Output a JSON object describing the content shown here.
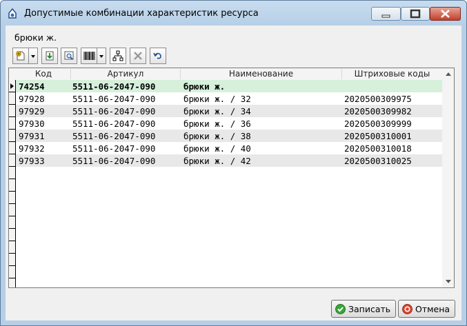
{
  "window": {
    "title": "Допустимые комбинации характеристик ресурса"
  },
  "subtitle": "брюки  ж.",
  "toolbar": {
    "buttons": [
      {
        "icon": "add-document-icon"
      },
      {
        "icon": "export-icon"
      },
      {
        "icon": "preview-icon"
      },
      {
        "icon": "barcode-icon"
      },
      {
        "icon": "hierarchy-icon"
      },
      {
        "icon": "delete-icon"
      },
      {
        "icon": "undo-icon"
      }
    ]
  },
  "grid": {
    "columns": [
      "Код",
      "Артикул",
      "Наименование",
      "Штриховые коды"
    ],
    "rows": [
      {
        "code": "74254",
        "article": "5511-06-2047-090",
        "name": "брюки  ж.",
        "barcode": "",
        "bold": true,
        "selected": true
      },
      {
        "code": "97928",
        "article": "5511-06-2047-090",
        "name": "брюки  ж.  / 32",
        "barcode": "2020500309975"
      },
      {
        "code": "97929",
        "article": "5511-06-2047-090",
        "name": "брюки  ж.  / 34",
        "barcode": "2020500309982"
      },
      {
        "code": "97930",
        "article": "5511-06-2047-090",
        "name": "брюки  ж.  / 36",
        "barcode": "2020500309999"
      },
      {
        "code": "97931",
        "article": "5511-06-2047-090",
        "name": "брюки  ж.  / 38",
        "barcode": "2020500310001"
      },
      {
        "code": "97932",
        "article": "5511-06-2047-090",
        "name": "брюки  ж.  / 40",
        "barcode": "2020500310018"
      },
      {
        "code": "97933",
        "article": "5511-06-2047-090",
        "name": "брюки  ж.  / 42",
        "barcode": "2020500310025"
      }
    ]
  },
  "buttons": {
    "save": "Записать",
    "cancel": "Отмена"
  },
  "colors": {
    "selected_row": "#d6f0dc",
    "alt_row": "#e8e8e8"
  }
}
